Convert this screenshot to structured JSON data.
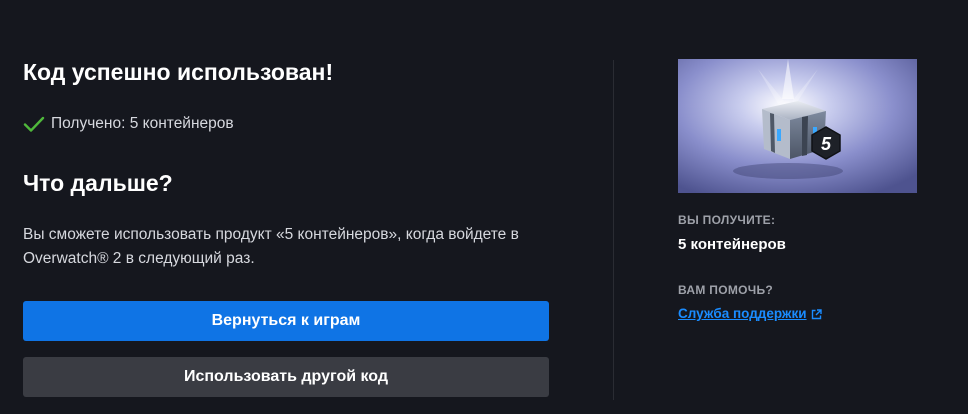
{
  "main": {
    "title": "Код успешно использован!",
    "received": "Получено: 5 контейнеров",
    "next_title": "Что дальше?",
    "description": "Вы сможете использовать продукт «5 контейнеров», когда войдете в Overwatch® 2 в следующий раз.",
    "primary_button": "Вернуться к играм",
    "secondary_button": "Использовать другой код"
  },
  "sidebar": {
    "image_badge": "5",
    "receive_label": "ВЫ ПОЛУЧИТЕ:",
    "product_name": "5 контейнеров",
    "help_label": "ВАМ ПОМОЧЬ?",
    "support_link": "Служба поддержки"
  },
  "icons": {
    "check": "check-icon",
    "external": "external-link-icon"
  },
  "colors": {
    "background": "#15171e",
    "primary": "#0f74e5",
    "secondary": "#3a3c43",
    "link": "#1a8cff",
    "success": "#4fb83b"
  }
}
